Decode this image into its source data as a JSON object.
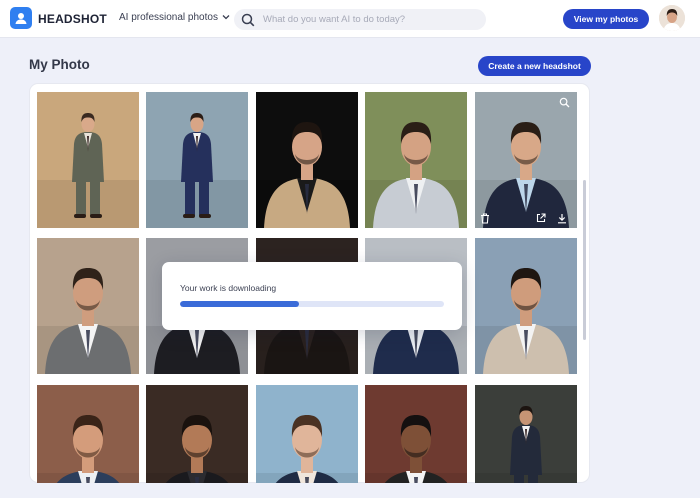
{
  "header": {
    "logo_text": "HEADSHOT",
    "nav_dropdown_label": "AI professional photos",
    "search_placeholder": "What do you want AI to do today?",
    "view_button_label": "View my photos"
  },
  "page": {
    "title": "My Photo",
    "create_button_label": "Create a new headshot"
  },
  "download_modal": {
    "message": "Your work is downloading",
    "progress": 0.45
  },
  "photos": [
    {
      "name": "photo-1",
      "bg": "#c9a77c",
      "suit": "#5f6455",
      "shirt": "#e7e2d8",
      "skin": "#d9a98a",
      "hair": "#3a2a20",
      "fullbody": true
    },
    {
      "name": "photo-2",
      "bg": "#8ea4b2",
      "suit": "#25305c",
      "shirt": "#f2f2f2",
      "skin": "#d8a586",
      "hair": "#2b1d16",
      "fullbody": true
    },
    {
      "name": "photo-3",
      "bg": "#0d0d0d",
      "suit": "#c7a982",
      "shirt": "#1a1a1a",
      "skin": "#d6a487",
      "hair": "#1e1510",
      "fullbody": false
    },
    {
      "name": "photo-4",
      "bg": "#7f8f5a",
      "suit": "#c7ccd3",
      "shirt": "#eef0f2",
      "skin": "#d4a283",
      "hair": "#2a1e16",
      "fullbody": false
    },
    {
      "name": "photo-5",
      "bg": "#9aa6ad",
      "suit": "#20273d",
      "shirt": "#bcd6ea",
      "skin": "#d8a888",
      "hair": "#2a1e16",
      "fullbody": false
    },
    {
      "name": "photo-6",
      "bg": "#b7a28d",
      "suit": "#6c6e70",
      "shirt": "#f4f4f4",
      "skin": "#cf9d7e",
      "hair": "#2f2219",
      "fullbody": false
    },
    {
      "name": "photo-7",
      "bg": "#9b9da2",
      "suit": "#1d1d22",
      "shirt": "#f1f1f1",
      "skin": "#b98363",
      "hair": "#1b1410",
      "fullbody": false
    },
    {
      "name": "photo-8",
      "bg": "#2c2320",
      "suit": "#1a1513",
      "shirt": "#2a211e",
      "skin": "#c99478",
      "hair": "#1b1410",
      "fullbody": false
    },
    {
      "name": "photo-9",
      "bg": "#b9bec4",
      "suit": "#1f2c4c",
      "shirt": "#e9edf2",
      "skin": "#d3a183",
      "hair": "#2a1e16",
      "fullbody": false
    },
    {
      "name": "photo-10",
      "bg": "#8aa0b5",
      "suit": "#cdbfae",
      "shirt": "#f3f3f3",
      "skin": "#cf9c7c",
      "hair": "#1f1712",
      "fullbody": false
    },
    {
      "name": "photo-11",
      "bg": "#8c5e4a",
      "suit": "#2c3e5c",
      "shirt": "#eef0f3",
      "skin": "#d49c7b",
      "hair": "#3a2418",
      "fullbody": false
    },
    {
      "name": "photo-12",
      "bg": "#3a2b24",
      "suit": "#1a1a1e",
      "shirt": "#2b2b30",
      "skin": "#b27a57",
      "hair": "#1a120e",
      "fullbody": false
    },
    {
      "name": "photo-13",
      "bg": "#8fb3cc",
      "suit": "#1f2b44",
      "shirt": "#f0e6dc",
      "skin": "#e0b59a",
      "hair": "#4a3223",
      "fullbody": false
    },
    {
      "name": "photo-14",
      "bg": "#6e3a30",
      "suit": "#222222",
      "shirt": "#f4f4f4",
      "skin": "#7e5037",
      "hair": "#141010",
      "fullbody": false
    },
    {
      "name": "photo-15",
      "bg": "#3b3e3a",
      "suit": "#232a3a",
      "shirt": "#f2f2f2",
      "skin": "#c69474",
      "hair": "#1c1410",
      "fullbody": true
    }
  ],
  "colors": {
    "accent": "#2845c9",
    "logo": "#2f7ff0",
    "progress": "#3a6bd8"
  }
}
